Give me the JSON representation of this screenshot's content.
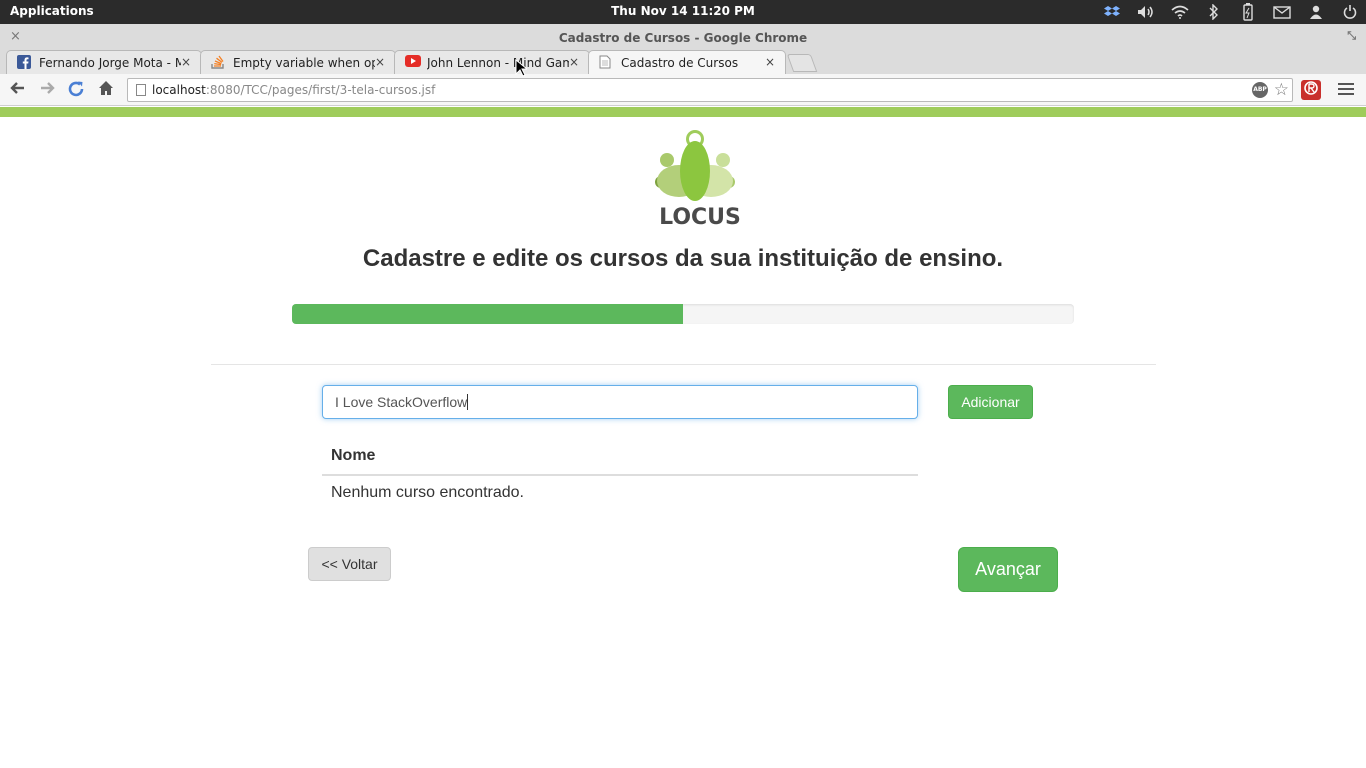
{
  "system_panel": {
    "applications_label": "Applications",
    "clock": "Thu Nov 14 11:20 PM",
    "tray_icons": [
      "dropbox-icon",
      "volume-icon",
      "wifi-icon",
      "bluetooth-icon",
      "battery-icon",
      "mail-icon",
      "user-icon",
      "power-icon"
    ]
  },
  "window": {
    "title": "Cadastro de Cursos - Google Chrome",
    "close_glyph": "×",
    "restore_glyph": "⤡"
  },
  "tabs": [
    {
      "label": "Fernando Jorge Mota - Mes",
      "icon": "facebook-icon",
      "close": "×"
    },
    {
      "label": "Empty variable when open",
      "icon": "stackoverflow-icon",
      "close": "×"
    },
    {
      "label": "John Lennon - Mind Games",
      "icon": "youtube-icon",
      "close": "×"
    },
    {
      "label": "Cadastro de Cursos",
      "icon": "page-icon",
      "close": "×"
    }
  ],
  "address_bar": {
    "host": "localhost",
    "path": ":8080/TCC/pages/first/3-tela-cursos.jsf",
    "abp_label": "ABP"
  },
  "page": {
    "logo_text": "LOCUS",
    "headline": "Cadastre e edite os cursos da sua instituição de ensino.",
    "progress_fraction": 0.5,
    "course_input_value": "I Love StackOverflow",
    "add_button": "Adicionar",
    "table": {
      "columns": [
        "Nome"
      ],
      "empty_message": "Nenhum curso encontrado."
    },
    "back_button": "<< Voltar",
    "next_button": "Avançar"
  },
  "colors": {
    "accent_green": "#5cb85c",
    "header_bar_green": "#9fcc5b",
    "logo_green": "#9fcc5b"
  }
}
